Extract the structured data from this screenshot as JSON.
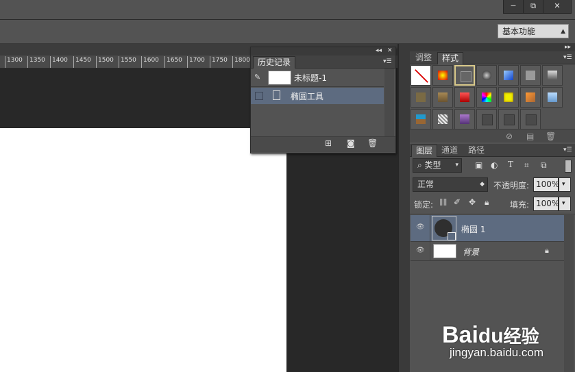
{
  "window": {
    "minimize": "−",
    "restore": "⧉",
    "close": "✕"
  },
  "options_bar": {
    "workspace": "基本功能"
  },
  "ruler": {
    "ticks": [
      "1300",
      "1350",
      "1400",
      "1450",
      "1500",
      "1550",
      "1600",
      "1650",
      "1700",
      "1750",
      "1800"
    ]
  },
  "history": {
    "tab": "历史记录",
    "snapshot_label": "未标题-1",
    "items": [
      {
        "label": "椭圆工具"
      }
    ]
  },
  "styles_panel": {
    "tabs": [
      "调整",
      "样式"
    ],
    "active_tab": "样式"
  },
  "layers_panel": {
    "tabs": [
      "图层",
      "通道",
      "路径"
    ],
    "filter_kind": "类型",
    "blend_mode": "正常",
    "opacity_label": "不透明度:",
    "opacity_value": "100%",
    "lock_label": "锁定:",
    "fill_label": "填充:",
    "fill_value": "100%",
    "layers": [
      {
        "name": "椭圆 1",
        "selected": true
      },
      {
        "name": "背景",
        "locked": true
      }
    ]
  },
  "watermark": {
    "brand": "Bai",
    "brand_suffix": "经验",
    "url": "jingyan.baidu.com"
  }
}
